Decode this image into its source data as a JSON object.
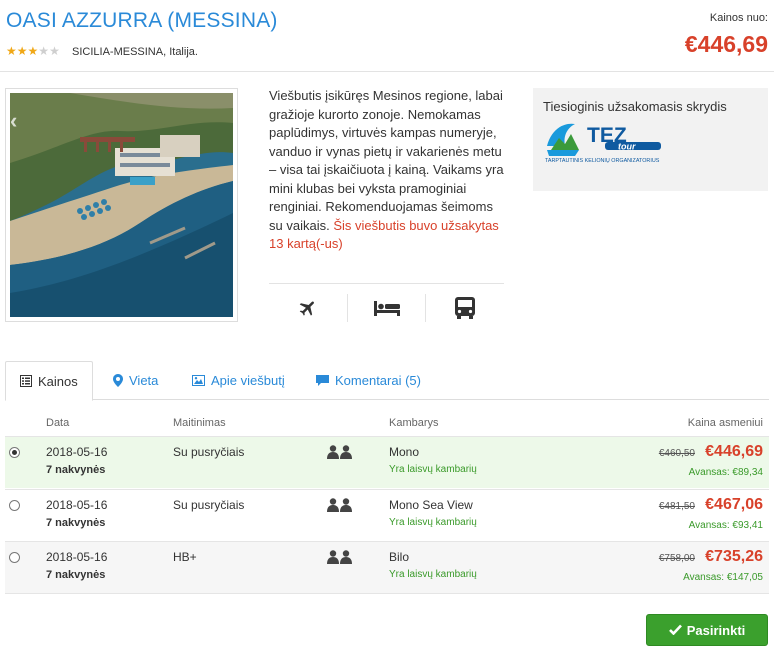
{
  "hotel": {
    "name": "OASI AZZURRA (MESSINA)",
    "stars_filled": 3,
    "stars_total": 5,
    "location_region": "SICILIA-MESSINA,",
    "location_country": "Italija."
  },
  "price": {
    "label": "Kainos nuo:",
    "value": "€446,69"
  },
  "description": {
    "text": "Viešbutis įsikūręs Mesinos regione, labai gražioje kurorto zonoje. Nemokamas paplūdimys, virtuvės kampas numeryje, vanduo ir vynas pietų ir vakarienės metu – visa tai įskaičiuota į kainą. Vaikams yra mini klubas bei vyksta pramoginiai renginiai. Rekomenduojamas šeimoms su vaikais.",
    "booked_note": "Šis viešbutis buvo užsakytas 13 kartą(-us)"
  },
  "features": [
    {
      "icon": "plane-icon"
    },
    {
      "icon": "bed-icon"
    },
    {
      "icon": "bus-icon"
    }
  ],
  "flight": {
    "label": "Tiesioginis užsakomasis skrydis",
    "logo_text": "TEZ",
    "logo_sub": "tour",
    "logo_caption": "TARPTAUTINIS KELIONIŲ ORGANIZATORIUS"
  },
  "tabs": [
    {
      "label": "Kainos",
      "icon": "list-icon",
      "active": true
    },
    {
      "label": "Vieta",
      "icon": "map-marker-icon",
      "active": false
    },
    {
      "label": "Apie viešbutį",
      "icon": "picture-icon",
      "active": false
    },
    {
      "label": "Komentarai (5)",
      "icon": "comment-icon",
      "active": false
    }
  ],
  "table": {
    "headers": {
      "date": "Data",
      "meal": "Maitinimas",
      "rooms": "Kambarys",
      "price": "Kaina asmeniui"
    },
    "rows": [
      {
        "selected": true,
        "date": "2018-05-16",
        "nights": "7 nakvynės",
        "meal": "Su pusryčiais",
        "room": "Mono",
        "availability": "Yra laisvų kambarių",
        "old_price": "€460,50",
        "price": "€446,69",
        "advance": "Avansas: €89,34"
      },
      {
        "selected": false,
        "date": "2018-05-16",
        "nights": "7 nakvynės",
        "meal": "Su pusryčiais",
        "room": "Mono Sea View",
        "availability": "Yra laisvų kambarių",
        "old_price": "€481,50",
        "price": "€467,06",
        "advance": "Avansas: €93,41"
      },
      {
        "selected": false,
        "date": "2018-05-16",
        "nights": "7 nakvynės",
        "meal": "HB+",
        "room": "Bilo",
        "availability": "Yra laisvų kambarių",
        "old_price": "€758,00",
        "price": "€735,26",
        "advance": "Avansas: €147,05"
      }
    ]
  },
  "actions": {
    "select_label": "Pasirinkti"
  },
  "colors": {
    "accent_blue": "#2a8ad8",
    "price_red": "#d8412a",
    "green": "#3ba02d",
    "selected_row": "#edf9e9"
  }
}
